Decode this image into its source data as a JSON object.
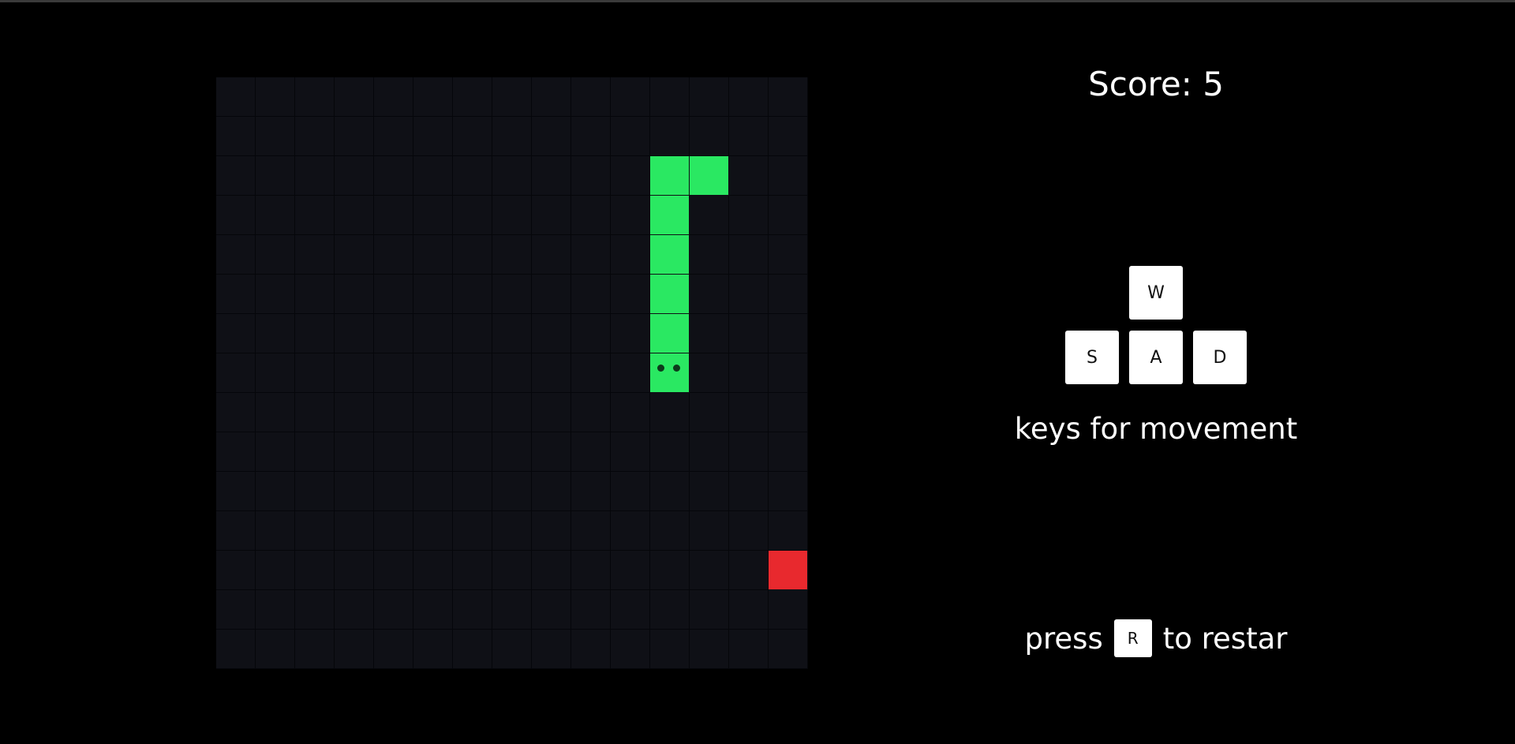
{
  "game": {
    "grid_size": 15,
    "snake": [
      [
        11,
        2
      ],
      [
        12,
        2
      ],
      [
        11,
        3
      ],
      [
        11,
        4
      ],
      [
        11,
        5
      ],
      [
        11,
        6
      ]
    ],
    "head": [
      11,
      7
    ],
    "food": [
      14,
      12
    ],
    "colors": {
      "snake": "#2ae862",
      "food": "#e8292e",
      "board": "#0f1016"
    }
  },
  "panel": {
    "score_text": "Score: 5",
    "keys": {
      "up": "W",
      "left": "S",
      "down": "A",
      "right": "D"
    },
    "keys_caption": "keys for movement",
    "restart_prefix": "press",
    "restart_key": "R",
    "restart_suffix": "to restar"
  }
}
